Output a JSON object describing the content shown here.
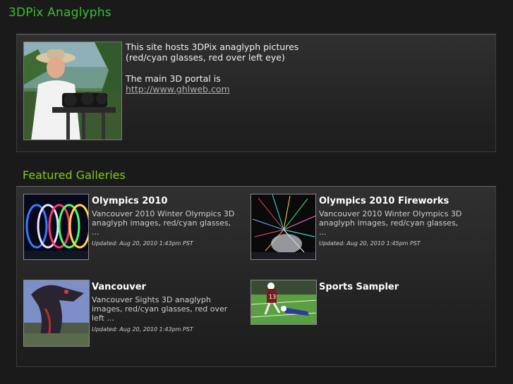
{
  "site": {
    "title": "3DPix Anaglyphs"
  },
  "intro": {
    "line1": "This site hosts 3DPix anaglyph pictures",
    "line2": "(red/cyan glasses, red over left eye)",
    "portal_text": "The main 3D portal is",
    "portal_link": "http://www.ghlweb.com"
  },
  "featured": {
    "title": "Featured Galleries",
    "galleries": [
      {
        "title": "Olympics 2010",
        "description": "Vancouver 2010 Winter Olympics 3D anaglyph images, red/cyan glasses, ...",
        "updated": "Updated: Aug 20, 2010 1:43pm PST"
      },
      {
        "title": "Olympics 2010 Fireworks",
        "description": "Vancouver 2010 Winter Olympics 3D anaglyph images, red/cyan glasses, ...",
        "updated": "Updated: Aug 20, 2010 1:45pm PST"
      },
      {
        "title": "Vancouver",
        "description": "Vancouver Sights 3D anaglyph images, red/cyan glasses, red over left ...",
        "updated": "Updated: Aug 20, 2010 1:43pm PST"
      },
      {
        "title": "Sports Sampler",
        "description": "",
        "updated": ""
      }
    ]
  },
  "colors": {
    "title_green": "#3bbf2e",
    "section_green": "#7fc91f",
    "background": "#1a1a1a"
  }
}
